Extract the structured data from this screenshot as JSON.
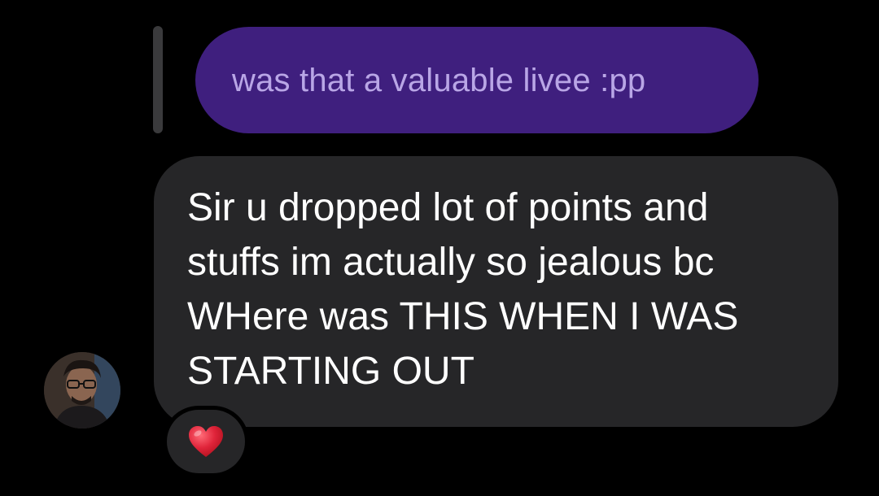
{
  "thread": {
    "replied_message": {
      "text": "was that a valuable livee :pp",
      "bubble_color": "#3f1f7e",
      "text_color": "#b9a6e6"
    },
    "message": {
      "text": "Sir u dropped lot of points and\nstuffs im actually so jealous bc\nWHere was THIS WHEN I WAS\nSTARTING OUT",
      "bubble_color": "#262628",
      "text_color": "#ffffff"
    },
    "sender_avatar": {
      "icon": "profile-photo"
    },
    "reaction": {
      "icon": "red-heart-icon",
      "color": "#e0243a"
    }
  }
}
